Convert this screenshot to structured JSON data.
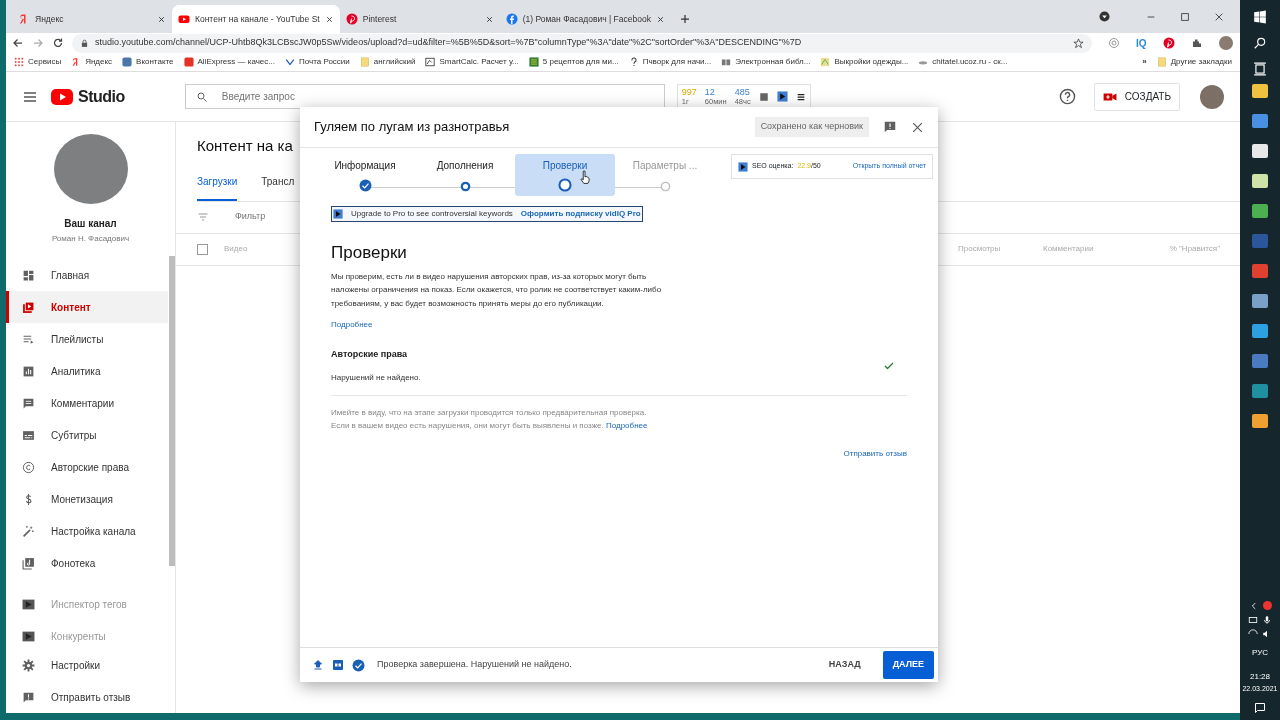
{
  "browser": {
    "tabs": [
      {
        "title": "Яндекс",
        "selected": false
      },
      {
        "title": "Контент на канале - YouTube St",
        "selected": true
      },
      {
        "title": "Pinterest",
        "selected": false
      },
      {
        "title": "(1) Роман Фасадович | Facebook",
        "selected": false
      }
    ],
    "url": "studio.youtube.com/channel/UCP-Uhtb8Qk3LCBscJW0p5Sw/videos/upload?d=ud&filter=%5B%5D&sort=%7B\"columnType\"%3A\"date\"%2C\"sortOrder\"%3A\"DESCENDING\"%7D",
    "extension_badge": "IQ",
    "bookmarks": [
      "Сервисы",
      "Яндекс",
      "Вконтакте",
      "AliExpress — качес...",
      "Почта России",
      "английский",
      "SmartCalc. Расчет у...",
      "5 рецептов для ми...",
      "Пчворк для начи...",
      "Электронная библ...",
      "Выкройки одежды...",
      "chitatel.ucoz.ru - ск..."
    ],
    "more_bookmarks": "»",
    "other_bookmarks": "Другие закладки"
  },
  "studio": {
    "logo": "Studio",
    "search": {
      "placeholder": "Введите запрос"
    },
    "stats": [
      {
        "value": "997",
        "label": "1г"
      },
      {
        "value": "12",
        "label": "60мин"
      },
      {
        "value": "485",
        "label": "48чс"
      }
    ],
    "create_button": "СОЗДАТЬ"
  },
  "sidebar": {
    "channel_title": "Ваш канал",
    "channel_owner": "Роман Н. Фасадович",
    "items": [
      {
        "label": "Главная",
        "selected": false,
        "disabled": false
      },
      {
        "label": "Контент",
        "selected": true,
        "disabled": false
      },
      {
        "label": "Плейлисты",
        "selected": false,
        "disabled": false
      },
      {
        "label": "Аналитика",
        "selected": false,
        "disabled": false
      },
      {
        "label": "Комментарии",
        "selected": false,
        "disabled": false
      },
      {
        "label": "Субтитры",
        "selected": false,
        "disabled": false
      },
      {
        "label": "Авторские права",
        "selected": false,
        "disabled": false
      },
      {
        "label": "Монетизация",
        "selected": false,
        "disabled": false
      },
      {
        "label": "Настройка канала",
        "selected": false,
        "disabled": false
      },
      {
        "label": "Фонотека",
        "selected": false,
        "disabled": false
      }
    ],
    "extension_items": [
      {
        "label": "Инспектор тегов",
        "selected": false,
        "disabled": true
      },
      {
        "label": "Конкуренты",
        "selected": false,
        "disabled": true
      }
    ],
    "bottom_items": [
      {
        "label": "Настройки",
        "selected": false,
        "disabled": false
      },
      {
        "label": "Отправить отзыв",
        "selected": false,
        "disabled": false
      }
    ]
  },
  "content": {
    "title": "Контент на ка",
    "tabs": [
      {
        "label": "Загрузки",
        "selected": true
      },
      {
        "label": "Трансл",
        "selected": false
      }
    ],
    "filter": {
      "placeholder": "Фильтр"
    },
    "select_all": {
      "checked": false
    },
    "columns": [
      "Видео",
      "Просмотры",
      "Комментарии",
      "% \"Нравится\""
    ]
  },
  "dialog": {
    "title": "Гуляем по лугам из разнотравья",
    "draft_badge": "Сохранено как черновик",
    "steps": [
      {
        "label": "Информация",
        "kind": "done",
        "selected": false
      },
      {
        "label": "Дополнения",
        "kind": "visited",
        "selected": false
      },
      {
        "label": "Проверки",
        "kind": "current",
        "selected": true
      },
      {
        "label": "Параметры ...",
        "kind": "pending",
        "selected": false
      }
    ],
    "seo": {
      "label": "SEO оценка:",
      "score": "22.9",
      "max": "/50",
      "link": "Открыть полный отчет"
    },
    "upgrade": {
      "text": "Upgrade to Pro to see controversial keywords",
      "link": "Оформить подписку vidIQ Pro"
    },
    "heading": "Проверки",
    "description": "Мы проверим, есть ли в видео нарушения авторских прав, из-за которых могут быть наложены ограничения на показ. Если окажется, что ролик не соответствует каким-либо требованиям, у вас будет возможность принять меры до его публикации.",
    "more_link": "Подробнее",
    "checks": [
      {
        "title": "Авторские права",
        "result": "Нарушений не найдено.",
        "passed": true
      }
    ],
    "note": "Имейте в виду, что на этапе загрузки проводится только предварительная проверка. Если в вашем видео есть нарушения, они могут быть выявлены и позже.",
    "note_link": "Подробнее",
    "feedback_link": "Отправить отзыв",
    "footer": {
      "status": "Проверка завершена. Нарушений не найдено.",
      "back": "НАЗАД",
      "next": "ДАЛЕЕ"
    }
  },
  "taskbar": {
    "language": "РУС",
    "time": "21:28",
    "date": "22.03.2021"
  }
}
